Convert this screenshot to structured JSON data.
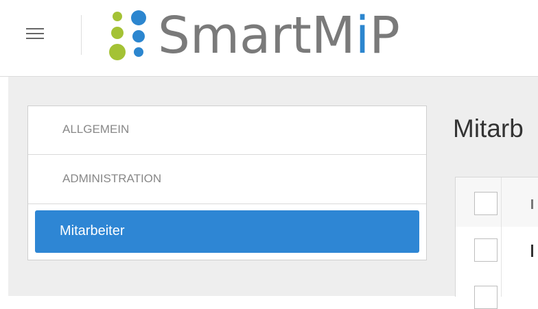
{
  "header": {
    "menu_icon": "hamburger-icon",
    "logo": {
      "text_main": "SmartM",
      "text_accent_i": "i",
      "text_tail": "P",
      "colors": {
        "dot_green": "#a4c235",
        "dot_blue": "#2c86cf",
        "text_gray": "#7a7a7a"
      }
    }
  },
  "sidebar": {
    "items": [
      {
        "label": "ALLGEMEIN"
      },
      {
        "label": "ADMINISTRATION"
      }
    ],
    "active_item": {
      "label": "Mitarbeiter"
    }
  },
  "main": {
    "title": "Mitarb"
  },
  "colors": {
    "accent": "#2e86d4",
    "background": "#eeeeee"
  }
}
